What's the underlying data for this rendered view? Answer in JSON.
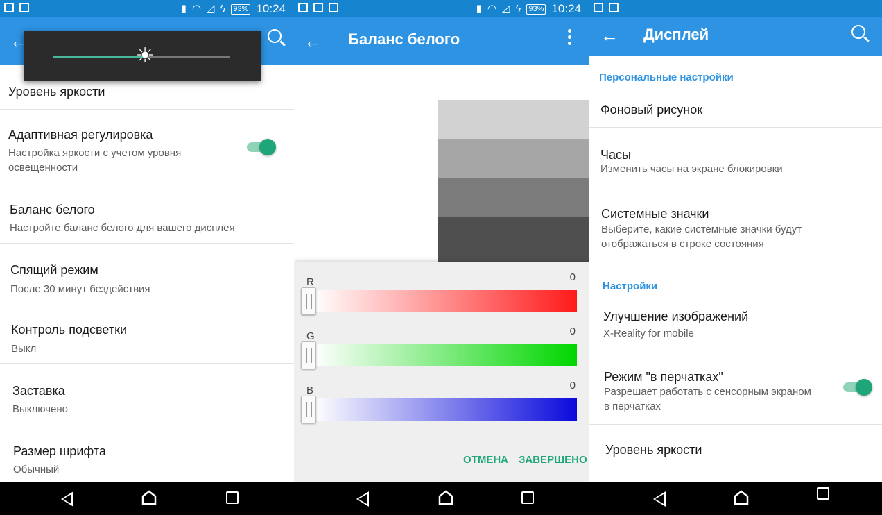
{
  "status": {
    "battery": "93%",
    "time": "10:24"
  },
  "colors": {
    "accent": "#2d93e2",
    "toggle_on": "#1fa57a"
  },
  "panel1": {
    "brightness_level": 0.52,
    "rows": [
      {
        "title": "Уровень яркости"
      },
      {
        "title": "Адаптивная регулировка",
        "subtitle": "Настройка яркости с учетом уровня освещенности",
        "toggle": true
      },
      {
        "title": "Баланс белого",
        "subtitle": "Настройте баланс белого для вашего дисплея"
      },
      {
        "title": "Спящий режим",
        "subtitle": "После 30 минут бездействия"
      },
      {
        "title": "Контроль подсветки",
        "subtitle": "Выкл"
      },
      {
        "title": "Заставка",
        "subtitle": "Выключено"
      },
      {
        "title": "Размер шрифта",
        "subtitle": "Обычный"
      }
    ]
  },
  "panel2": {
    "title": "Баланс белого",
    "channels": [
      {
        "label": "R",
        "value": "0"
      },
      {
        "label": "G",
        "value": "0"
      },
      {
        "label": "B",
        "value": "0"
      }
    ],
    "cancel": "ОТМЕНА",
    "done": "ЗАВЕРШЕНО"
  },
  "panel3": {
    "title": "Дисплей",
    "section1": "Персональные настройки",
    "rows1": [
      {
        "title": "Фоновый рисунок"
      },
      {
        "title": "Часы",
        "subtitle": "Изменить часы на экране блокировки"
      },
      {
        "title": "Системные значки",
        "subtitle": "Выберите, какие системные значки будут отображаться в строке состояния"
      }
    ],
    "section2": "Настройки",
    "rows2": [
      {
        "title": "Улучшение изображений",
        "subtitle": "X-Reality for mobile"
      },
      {
        "title": "Режим \"в перчатках\"",
        "subtitle": "Разрешает работать с сенсорным экраном в перчатках",
        "toggle": true
      },
      {
        "title": "Уровень яркости"
      }
    ]
  }
}
